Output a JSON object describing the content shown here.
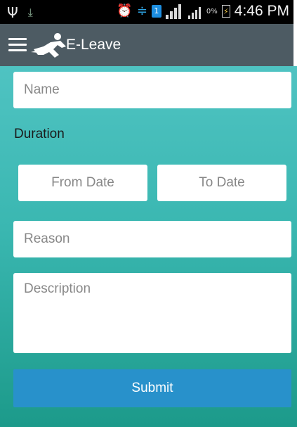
{
  "status_bar": {
    "icons": [
      "usb-icon",
      "download-icon",
      "alarm-icon",
      "wifi-icon",
      "sim-1-icon",
      "signal-icon",
      "battery-icon"
    ],
    "sim_badge": "1",
    "battery_percent": "0%",
    "time": "4:46 PM"
  },
  "app_bar": {
    "title": "E-Leave",
    "background_color": "#4d5b63"
  },
  "form": {
    "name_placeholder": "Name",
    "duration_label": "Duration",
    "from_date_placeholder": "From Date",
    "to_date_placeholder": "To Date",
    "reason_placeholder": "Reason",
    "description_placeholder": "Description",
    "submit_label": "Submit",
    "background_top_color": "#4fc3c2",
    "background_bottom_color": "#1c9a8a",
    "submit_color": "#2891cb"
  }
}
